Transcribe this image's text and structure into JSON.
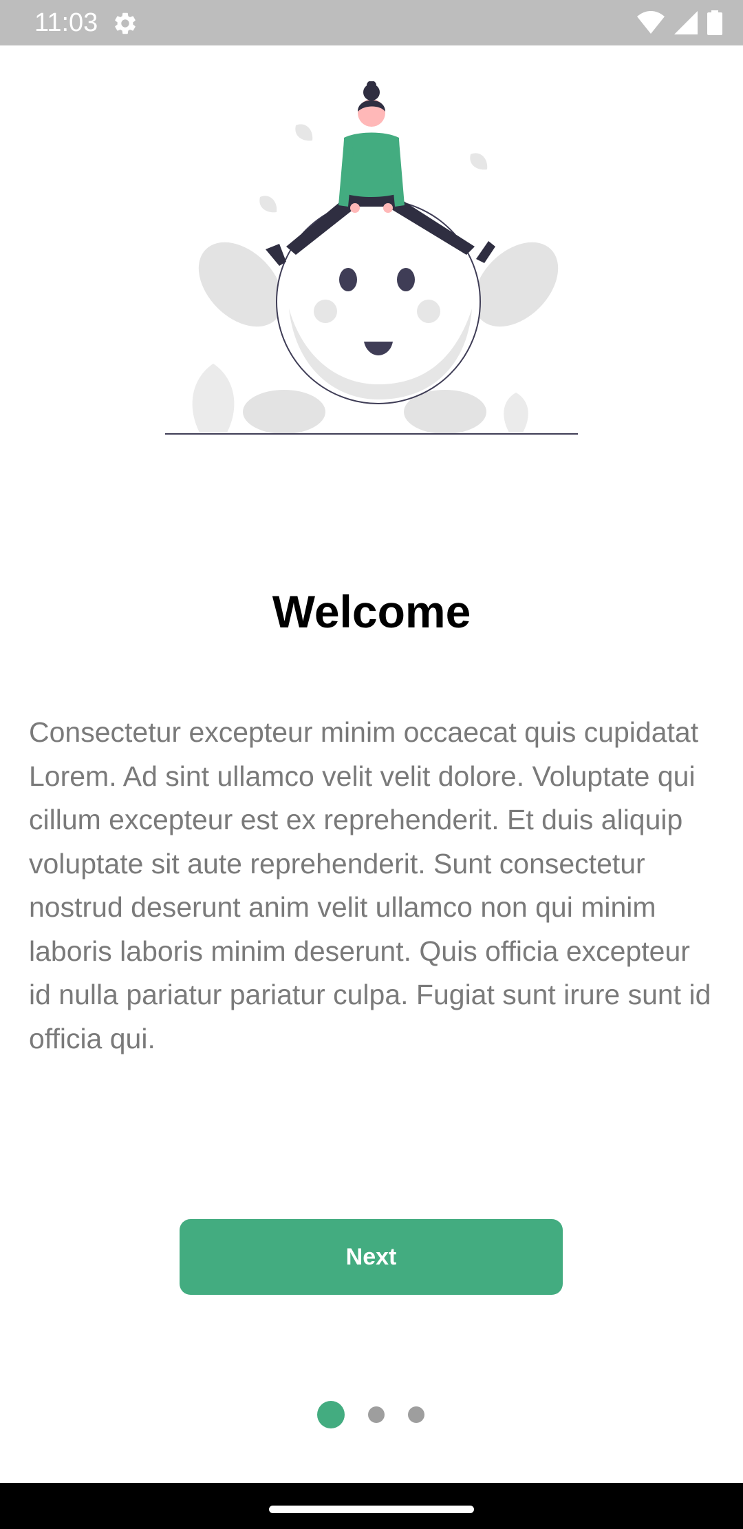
{
  "status_bar": {
    "time": "11:03",
    "icons": [
      "gear-icon",
      "wifi-icon",
      "signal-icon",
      "battery-icon"
    ]
  },
  "onboarding": {
    "title": "Welcome",
    "body": "Consectetur excepteur minim occaecat quis cupidatat Lorem. Ad sint ullamco velit velit dolore. Voluptate qui cillum excepteur est ex reprehenderit. Et duis aliquip voluptate sit aute reprehenderit. Sunt consectetur nostrud deserunt anim velit ullamco non qui minim laboris laboris minim deserunt. Quis officia excepteur id nulla pariatur pariatur culpa. Fugiat sunt irure sunt id officia qui.",
    "next_label": "Next",
    "page_count": 3,
    "current_page": 1
  },
  "colors": {
    "accent": "#43ac80",
    "status_bar_bg": "#bdbdbd",
    "body_text": "#7a7a7a",
    "dot_inactive": "#9e9e9e",
    "nav_bar_bg": "#000000"
  }
}
